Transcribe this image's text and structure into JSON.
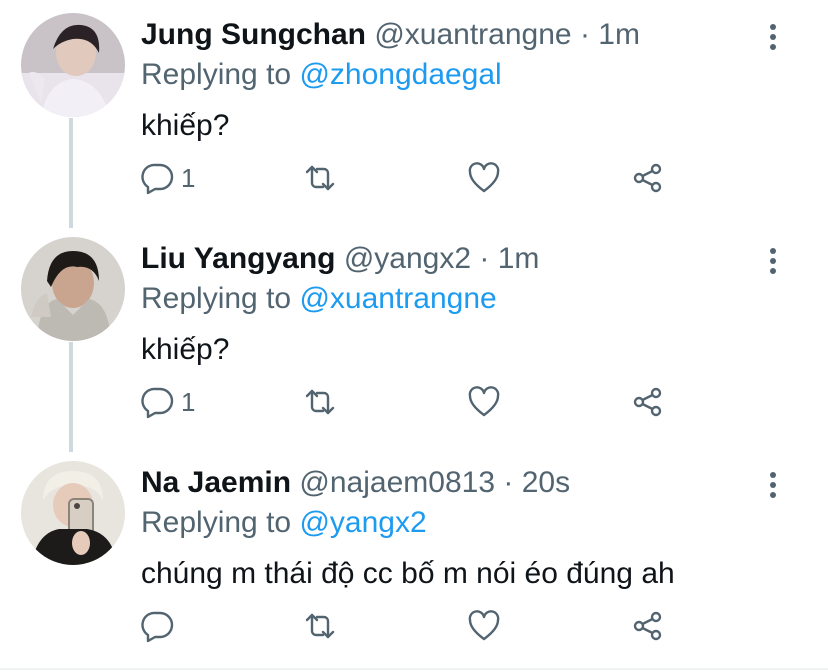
{
  "colors": {
    "name": "#0f1419",
    "muted": "#536471",
    "mention": "#1d9bf0",
    "thread": "#cfd9de"
  },
  "tweets": [
    {
      "name": "Jung Sungchan",
      "handle": "@xuantrangne",
      "dot": "·",
      "time": "1m",
      "replying_prefix": "Replying to",
      "replying_to": "@zhongdaegal",
      "text": "khiếp?",
      "reply_count": "1",
      "avatar_icon": "avatar-photo"
    },
    {
      "name": "Liu Yangyang",
      "handle": "@yangx2",
      "dot": "·",
      "time": "1m",
      "replying_prefix": "Replying to",
      "replying_to": "@xuantrangne",
      "text": "khiếp?",
      "reply_count": "1",
      "avatar_icon": "avatar-photo"
    },
    {
      "name": "Na Jaemin",
      "handle": "@najaem0813",
      "dot": "·",
      "time": "20s",
      "replying_prefix": "Replying to",
      "replying_to": "@yangx2",
      "text": "chúng m thái độ cc bố m nói éo đúng ah",
      "reply_count": "",
      "avatar_icon": "avatar-photo"
    }
  ],
  "icons": {
    "reply": "reply-icon",
    "retweet": "retweet-icon",
    "like": "heart-icon",
    "share": "share-icon",
    "more": "more-vertical-icon"
  }
}
